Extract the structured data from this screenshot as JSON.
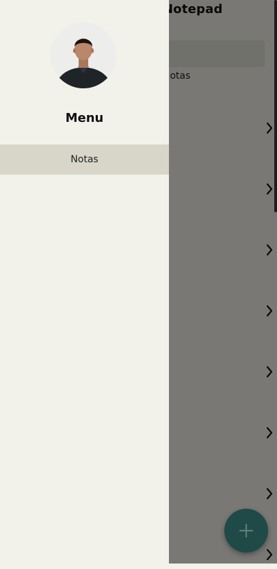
{
  "app": {
    "title": "Notepad",
    "subtitle": "Notas",
    "note_rows": [
      "",
      "",
      "",
      "",
      "",
      "",
      "",
      ""
    ]
  },
  "drawer": {
    "title": "Menu",
    "items": [
      {
        "label": "Notas",
        "selected": true
      }
    ]
  },
  "colors": {
    "background": "#f2f1ea",
    "selected_item": "#d8d6c9",
    "fab": "#1f4a48",
    "overlay": "rgba(0,0,0,0.5)"
  },
  "icons": {
    "back": "chevron-left-icon",
    "row": "chevron-right-icon",
    "fab": "plus-icon"
  }
}
